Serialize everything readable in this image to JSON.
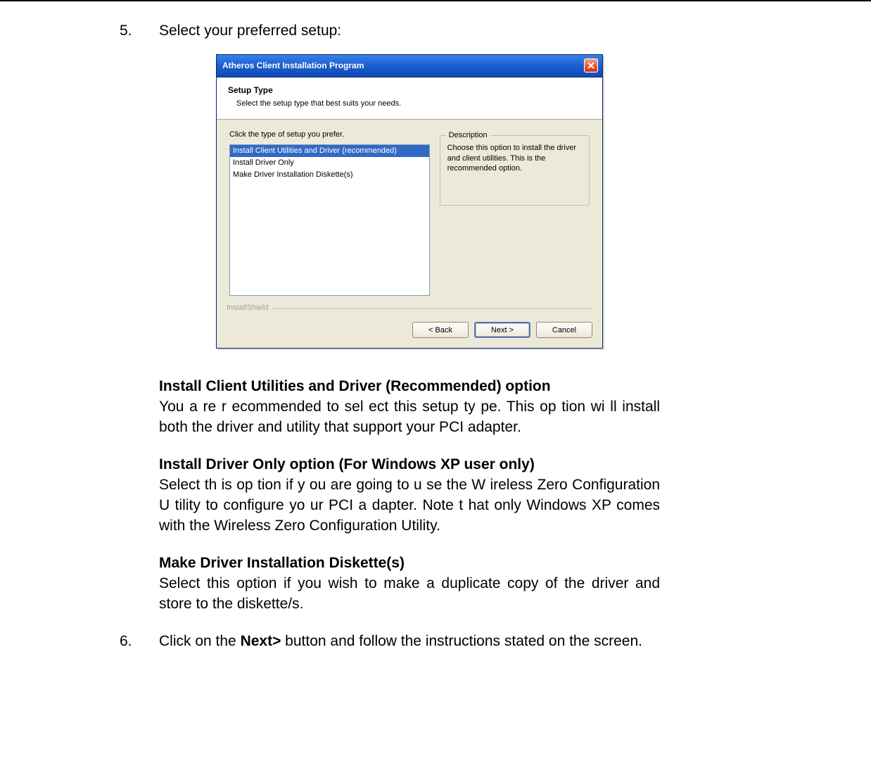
{
  "step5": {
    "number": "5.",
    "text": "Select your preferred setup:"
  },
  "dialog": {
    "title": "Atheros Client Installation Program",
    "header": {
      "title": "Setup Type",
      "subtitle": "Select the setup type that best suits your needs."
    },
    "instruction": "Click the type of setup you prefer.",
    "options": [
      "Install Client Utilities and Driver (recommended)",
      "Install Driver Only",
      "Make Driver Installation Diskette(s)"
    ],
    "selected_index": 0,
    "description_legend": "Description",
    "description_text": "Choose this option to install the driver and client utilities. This is the recommended option.",
    "install_shield": "InstallShield",
    "buttons": {
      "back": "< Back",
      "next": "Next >",
      "cancel": "Cancel"
    }
  },
  "sections": {
    "install_utilities_title": "Install Client Utilities and Driver (Recommended) option",
    "install_utilities_text": "You a re r ecommended  to sel ect  this  setup ty pe. This op  tion wi ll install both the driver and utility that support your PCI adapter.",
    "install_driver_title": "Install Driver Only option (For Windows XP user only)",
    "install_driver_text": "Select th  is op  tion if y   ou are    going   to u  se the W   ireless Zero Configuration U tility to configure yo  ur PCI a dapter.  Note t hat only Windows XP comes with the Wireless Zero Configuration Utility.",
    "make_diskette_title": "Make Driver Installation Diskette(s)",
    "make_diskette_text": "Select this option if you wish to make a duplicate copy of the driver and store to the diskette/s."
  },
  "step6": {
    "number": "6.",
    "prefix": "Click on the ",
    "bold": "Next>",
    "suffix": " button and follow the instructions stated on the screen."
  }
}
